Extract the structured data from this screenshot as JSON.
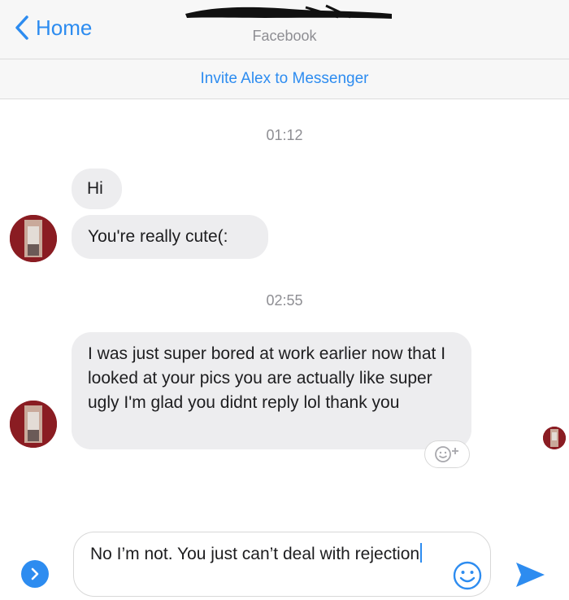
{
  "navbar": {
    "back_label": "Home",
    "subtitle": "Facebook"
  },
  "invite": {
    "label": "Invite Alex to Messenger"
  },
  "conversation": {
    "groups": [
      {
        "timestamp": "01:12",
        "messages": [
          "Hi",
          "You're really cute(:"
        ]
      },
      {
        "timestamp": "02:55",
        "messages": [
          "I was just super bored at work earlier now that I looked at your pics you are actually like super ugly I'm glad you didnt reply lol thank you"
        ]
      }
    ]
  },
  "composer": {
    "draft_text": "No I’m not. You just can’t deal with rejection"
  },
  "colors": {
    "accent": "#2d8cf0",
    "incoming_bubble": "#ededef",
    "avatar_bg": "#8a1c22"
  },
  "icons": {
    "back": "chevron-left-icon",
    "reaction": "add-reaction-icon",
    "expand": "chevron-right-icon",
    "emoji": "smiley-icon",
    "send": "send-arrow-icon"
  }
}
